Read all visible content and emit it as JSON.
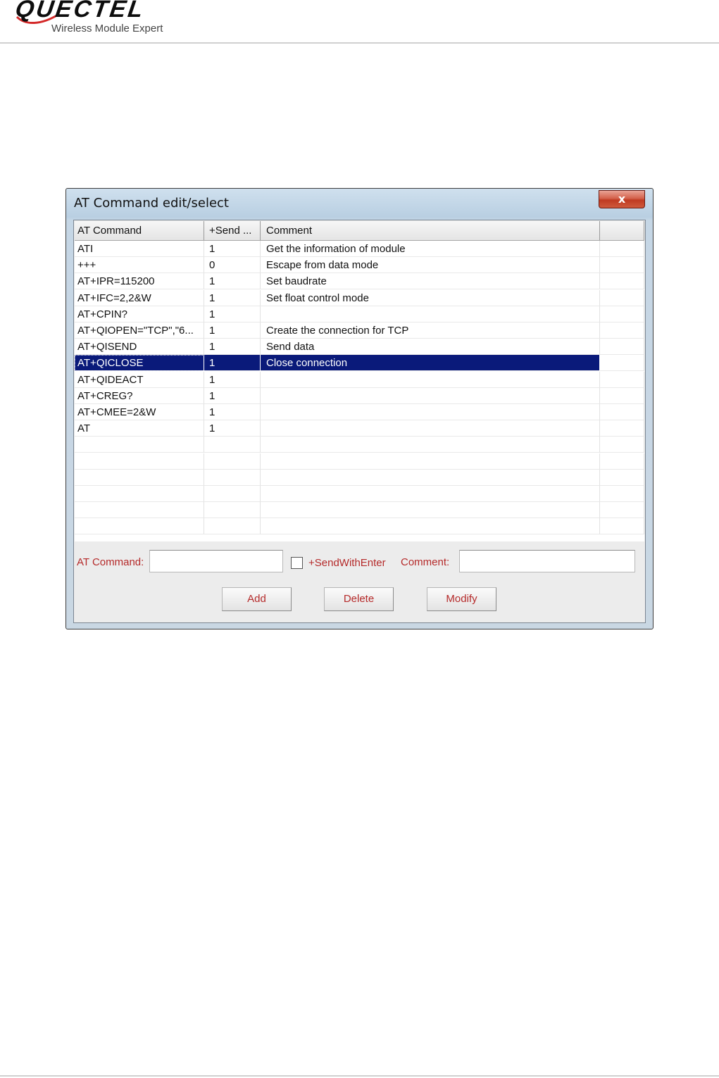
{
  "header": {
    "logo_text": "QUECTEL",
    "tagline": "Wireless Module Expert"
  },
  "dialog": {
    "title": "AT Command edit/select",
    "close_glyph": "x",
    "columns": [
      "AT Command",
      "+Send ...",
      "Comment",
      ""
    ],
    "rows": [
      {
        "command": "ATI",
        "send": "1",
        "comment": "Get the information of module"
      },
      {
        "command": "+++",
        "send": "0",
        "comment": "Escape from data mode"
      },
      {
        "command": "AT+IPR=115200",
        "send": "1",
        "comment": "Set baudrate"
      },
      {
        "command": "AT+IFC=2,2&W",
        "send": "1",
        "comment": "Set float control mode"
      },
      {
        "command": "AT+CPIN?",
        "send": "1",
        "comment": ""
      },
      {
        "command": "AT+QIOPEN=\"TCP\",\"6...",
        "send": "1",
        "comment": "Create the connection for TCP"
      },
      {
        "command": "AT+QISEND",
        "send": "1",
        "comment": "Send data"
      },
      {
        "command": "AT+QICLOSE",
        "send": "1",
        "comment": "Close connection",
        "selected": true
      },
      {
        "command": "AT+QIDEACT",
        "send": "1",
        "comment": ""
      },
      {
        "command": "AT+CREG?",
        "send": "1",
        "comment": ""
      },
      {
        "command": "AT+CMEE=2&W",
        "send": "1",
        "comment": ""
      },
      {
        "command": "AT",
        "send": "1",
        "comment": ""
      }
    ],
    "empty_rows": 6,
    "form": {
      "at_command_label": "AT Command:",
      "at_command_value": "",
      "send_with_enter_label": "+SendWithEnter",
      "send_with_enter_checked": false,
      "comment_label": "Comment:",
      "comment_value": ""
    },
    "buttons": {
      "add": "Add",
      "delete": "Delete",
      "modify": "Modify"
    },
    "colors": {
      "selection": "#0a1a7a",
      "label_text": "#b52a2a"
    }
  }
}
